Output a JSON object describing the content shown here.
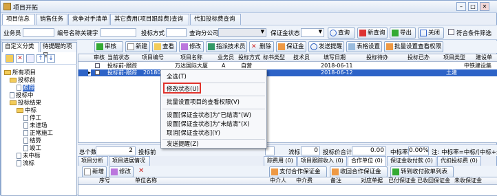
{
  "window": {
    "title": "项目开拓"
  },
  "top_tabs": [
    "项目信息",
    "销售任务",
    "竞争对手清单",
    "其它费用(项目跟踪费)查询",
    "代扣投标费查询"
  ],
  "search": {
    "salesperson_label": "业务员",
    "keyword_label": "编号名称关键字",
    "bid_method_label": "投标方式",
    "company_label": "查询分公司",
    "guarantee_label": "保证金状态",
    "query_button": "查询",
    "new_query_button": "新查询",
    "export_button": "导出",
    "close_button": "关闭",
    "match_all_label": "符合条件筛选"
  },
  "left_panel": {
    "tabs": [
      "自定义分类",
      "待提醒的项目"
    ],
    "tree": [
      {
        "label": "所有项目",
        "level": 0,
        "kind": "folder"
      },
      {
        "label": "投标前",
        "level": 1,
        "kind": "folder"
      },
      {
        "label": "跟踪",
        "level": 2,
        "kind": "doc"
      },
      {
        "label": "投标中",
        "level": 1,
        "kind": "doc"
      },
      {
        "label": "投标结果",
        "level": 1,
        "kind": "folder"
      },
      {
        "label": "中标",
        "level": 2,
        "kind": "folder"
      },
      {
        "label": "停工",
        "level": 3,
        "kind": "doc"
      },
      {
        "label": "未进场",
        "level": 3,
        "kind": "doc"
      },
      {
        "label": "正常施工",
        "level": 3,
        "kind": "doc"
      },
      {
        "label": "结算",
        "level": 3,
        "kind": "doc"
      },
      {
        "label": "竣工",
        "level": 3,
        "kind": "doc"
      },
      {
        "label": "未中标",
        "level": 2,
        "kind": "doc"
      },
      {
        "label": "流标",
        "level": 2,
        "kind": "doc"
      }
    ]
  },
  "toolbar": [
    "审核",
    "新建",
    "查看",
    "修改",
    "指派技术员",
    "删除",
    "保证金",
    "发送提醒",
    "表格设置",
    "批量设置查看权限"
  ],
  "grid": {
    "headers": [
      "审核",
      "当前状态",
      "项目编号",
      "项目名称",
      "业务员",
      "投标方式",
      "标书类型",
      "技术员",
      "填写日期",
      "投标待办",
      "投标已办",
      "项目类型",
      "建设单"
    ],
    "rows": [
      {
        "status": "投标前-跟踪",
        "name": "万达国际大厦",
        "salesperson": "A",
        "method": "自营",
        "date": "2018-06-11",
        "type": "",
        "builder": "中铁建设集"
      },
      {
        "status": "投标前-跟踪",
        "code": "201806",
        "name": "",
        "salesperson": "",
        "method": "",
        "date": "2018-06-12",
        "type": "土建",
        "builder": ""
      }
    ]
  },
  "summary": {
    "total_label": "总个数",
    "total_value": "2",
    "bid_label": "投标前",
    "flow_label": "流标",
    "flow_value": "0",
    "bid_total_label": "投标价合计",
    "bid_total_value": "0.00",
    "win_rate_label": "中标率",
    "win_rate_value": "0.00%",
    "note": "注: 中标率=中标/(中标+未"
  },
  "bottom_tabs": [
    "项目分析",
    "项目进展情况",
    "踪费用 (0)",
    "项目跟踪收入 (0)",
    "合作单位 (0)",
    "保证金收付款 (0)",
    "代扣投标费 (0)"
  ],
  "bottom_toolbar": [
    "新增",
    "修改",
    "支付合作保证金",
    "收回合作保证金",
    "转到收付款单列表"
  ],
  "bottom_grid_headers": [
    "序号",
    "单位名称",
    "中介人",
    "中介费",
    "备注",
    "对应单据",
    "已付保证金",
    "已收回保证金",
    "未收保证金"
  ],
  "context_menu": [
    "全选(T)",
    "修改状态(U)",
    "批量设置项目的查看权限(V)",
    "设置[保证金状态]为\"已结清\"(W)",
    "设置[保证金状态]为\"未结清\"(X)",
    "取消[保证金状态](Y)",
    "发送提醒(Z)"
  ],
  "colors": {
    "selection": "#2d63c7",
    "highlight_box": "#e0322b"
  }
}
